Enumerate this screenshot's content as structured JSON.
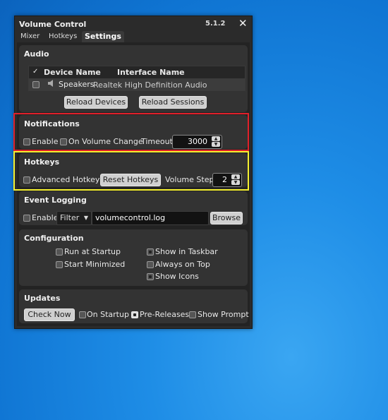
{
  "window": {
    "title": "Volume Control",
    "version": "5.1.2",
    "close_glyph": "✕"
  },
  "tabs": [
    {
      "label": "Mixer"
    },
    {
      "label": "Hotkeys"
    },
    {
      "label": "Settings",
      "active": true
    }
  ],
  "audio": {
    "title": "Audio",
    "columns": [
      "✓",
      "Device Name",
      "Interface Name"
    ],
    "devices": [
      {
        "name": "Speakers",
        "interface": "Realtek High Definition Audio",
        "checked": false,
        "icon": "speaker-icon"
      }
    ],
    "reload_devices": "Reload Devices",
    "reload_sessions": "Reload Sessions"
  },
  "notifications": {
    "title": "Notifications",
    "enable": "Enable",
    "on_volume_change": "On Volume Change",
    "timeout_label": "Timeout",
    "timeout_value": "3000"
  },
  "hotkeys": {
    "title": "Hotkeys",
    "advanced": "Advanced Hotkeys",
    "reset": "Reset Hotkeys",
    "step_label": "Volume Step",
    "step_value": "2"
  },
  "logging": {
    "title": "Event Logging",
    "enable": "Enable",
    "filter": "Filter",
    "file": "volumecontrol.log",
    "browse": "Browse"
  },
  "configuration": {
    "title": "Configuration",
    "run_at_startup": "Run at Startup",
    "start_minimized": "Start Minimized",
    "show_in_taskbar": "Show in Taskbar",
    "always_on_top": "Always on Top",
    "show_icons": "Show Icons"
  },
  "updates": {
    "title": "Updates",
    "check_now": "Check Now",
    "on_startup": "On Startup",
    "pre_releases": "Pre-Releases",
    "show_prompt": "Show Prompt"
  },
  "colors": {
    "window_bg": "#2b2b2b",
    "group_bg": "#333333",
    "highlight_notifications": "#e0202a",
    "highlight_hotkeys": "#f4f030",
    "desktop": "#1e8de6"
  }
}
